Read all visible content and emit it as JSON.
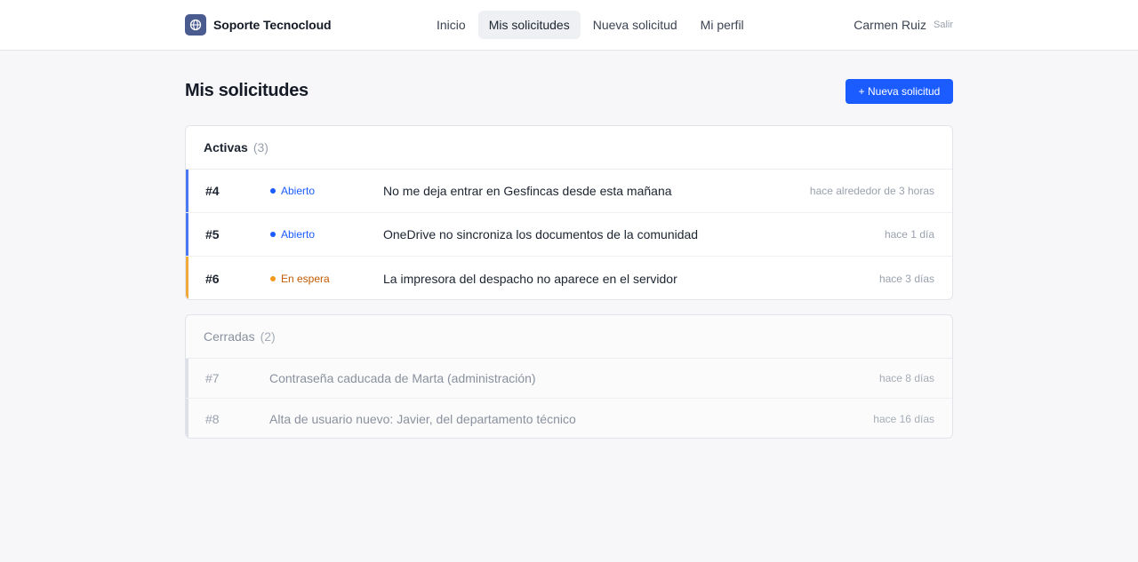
{
  "header": {
    "brand": "Soporte Tecnocloud",
    "brand_icon": "globe-icon",
    "nav": [
      {
        "label": "Inicio",
        "active": false
      },
      {
        "label": "Mis solicitudes",
        "active": true
      },
      {
        "label": "Nueva solicitud",
        "active": false
      },
      {
        "label": "Mi perfil",
        "active": false
      }
    ],
    "user_name": "Carmen Ruiz",
    "logout_label": "Salir"
  },
  "page": {
    "title": "Mis solicitudes",
    "new_button_label": "+ Nueva solicitud"
  },
  "colors": {
    "accent": "#1a5cff",
    "status_open": "#1a5cff",
    "status_waiting": "#f29a1f"
  },
  "active_section": {
    "title": "Activas",
    "count": "(3)",
    "tickets": [
      {
        "id": "#4",
        "status": "Abierto",
        "status_color": "#1a5cff",
        "status_text_color": "#1a5cff",
        "bar_color": "#4a78f0",
        "subject": "No me deja entrar en Gesfincas desde esta mañana",
        "time": "hace alrededor de 3 horas"
      },
      {
        "id": "#5",
        "status": "Abierto",
        "status_color": "#1a5cff",
        "status_text_color": "#1a5cff",
        "bar_color": "#4a78f0",
        "subject": "OneDrive no sincroniza los documentos de la comunidad",
        "time": "hace 1 día"
      },
      {
        "id": "#6",
        "status": "En espera",
        "status_color": "#f29a1f",
        "status_text_color": "#c25a00",
        "bar_color": "#f2a93b",
        "subject": "La impresora del despacho no aparece en el servidor",
        "time": "hace 3 días"
      }
    ]
  },
  "closed_section": {
    "title": "Cerradas",
    "count": "(2)",
    "tickets": [
      {
        "id": "#7",
        "subject": "Contraseña caducada de Marta (administración)",
        "time": "hace 8 días"
      },
      {
        "id": "#8",
        "subject": "Alta de usuario nuevo: Javier, del departamento técnico",
        "time": "hace 16 días"
      }
    ]
  }
}
